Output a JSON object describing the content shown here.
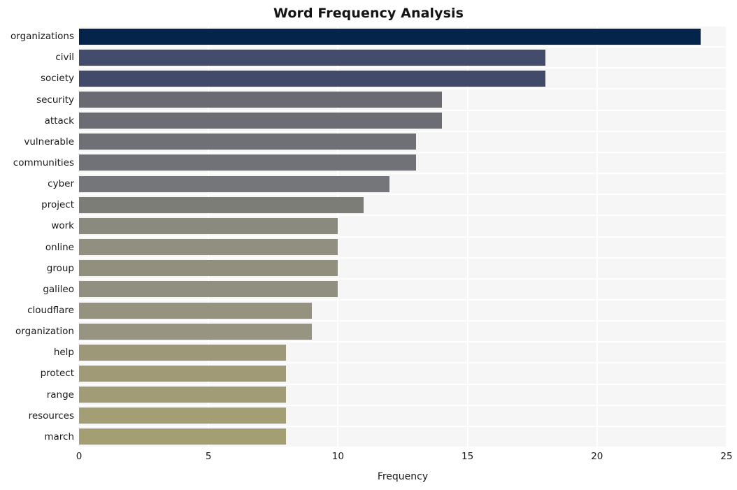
{
  "chart_data": {
    "type": "bar",
    "orientation": "horizontal",
    "title": "Word Frequency Analysis",
    "xlabel": "Frequency",
    "ylabel": "",
    "xlim": [
      0,
      25
    ],
    "xticks": [
      0,
      5,
      10,
      15,
      20,
      25
    ],
    "xtick_labels": [
      "0",
      "5",
      "10",
      "15",
      "20",
      "25"
    ],
    "grid": true,
    "grid_color": "#ffffff",
    "plot_background": "#f6f6f7",
    "figure_background": "#ffffff",
    "legend": null,
    "categories": [
      "organizations",
      "civil",
      "society",
      "security",
      "attack",
      "vulnerable",
      "communities",
      "cyber",
      "project",
      "work",
      "online",
      "group",
      "galileo",
      "cloudflare",
      "organization",
      "help",
      "protect",
      "range",
      "resources",
      "march"
    ],
    "values": [
      24,
      18,
      18,
      14,
      14,
      13,
      13,
      12,
      11,
      10,
      10,
      10,
      10,
      9,
      9,
      8,
      8,
      8,
      8,
      8
    ],
    "bar_colors": [
      "#04244b",
      "#434c6b",
      "#414a68",
      "#6a6b72",
      "#6c6d74",
      "#6f7076",
      "#717278",
      "#75767a",
      "#7d7d78",
      "#8a8a7e",
      "#919080",
      "#918f7d",
      "#919080",
      "#95937f",
      "#979481",
      "#9d9878",
      "#a09b76",
      "#a19c75",
      "#a39e74",
      "#a49f73"
    ]
  }
}
